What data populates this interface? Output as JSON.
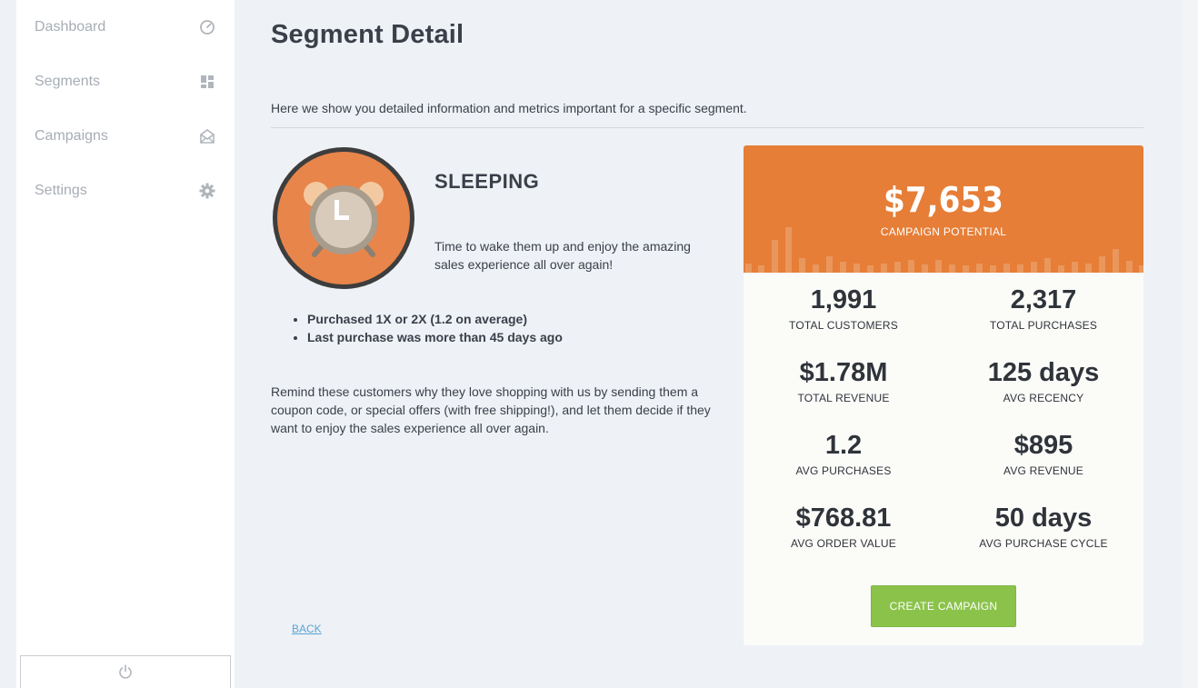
{
  "sidebar": {
    "items": [
      {
        "label": "Dashboard",
        "icon": "gauge-icon"
      },
      {
        "label": "Segments",
        "icon": "grid-icon"
      },
      {
        "label": "Campaigns",
        "icon": "mail-icon"
      },
      {
        "label": "Settings",
        "icon": "gear-icon"
      }
    ],
    "logout_icon": "power-icon"
  },
  "page": {
    "title": "Segment Detail",
    "intro": "Here we show you detailed information and metrics important for a specific segment."
  },
  "segment": {
    "name": "SLEEPING",
    "icon": "alarm-clock-icon",
    "tagline": "Time to wake them up and enjoy the amazing sales experience all over again!",
    "criteria": [
      "Purchased 1X or 2X (1.2 on average)",
      "Last purchase was more than 45 days ago"
    ],
    "description": "Remind these customers why they love shopping with us by sending them a coupon code, or special offers (with free shipping!), and let them decide if they want to enjoy the sales experience all over again.",
    "back_label": "BACK"
  },
  "metrics_card": {
    "potential_value": "$7,653",
    "potential_label": "CAMPAIGN POTENTIAL",
    "metrics": [
      {
        "value": "1,991",
        "label": "TOTAL CUSTOMERS"
      },
      {
        "value": "2,317",
        "label": "TOTAL PURCHASES"
      },
      {
        "value": "$1.78M",
        "label": "TOTAL REVENUE"
      },
      {
        "value": "125 days",
        "label": "AVG RECENCY"
      },
      {
        "value": "1.2",
        "label": "AVG PURCHASES"
      },
      {
        "value": "$895",
        "label": "AVG REVENUE"
      },
      {
        "value": "$768.81",
        "label": "AVG ORDER VALUE"
      },
      {
        "value": "50 days",
        "label": "AVG PURCHASE CYCLE"
      }
    ],
    "cta_label": "CREATE CAMPAIGN"
  },
  "colors": {
    "accent_orange": "#e67e37",
    "cta_green": "#8bc34a",
    "link_blue": "#5aa3d6",
    "sidebar_text": "#a7adb5"
  }
}
